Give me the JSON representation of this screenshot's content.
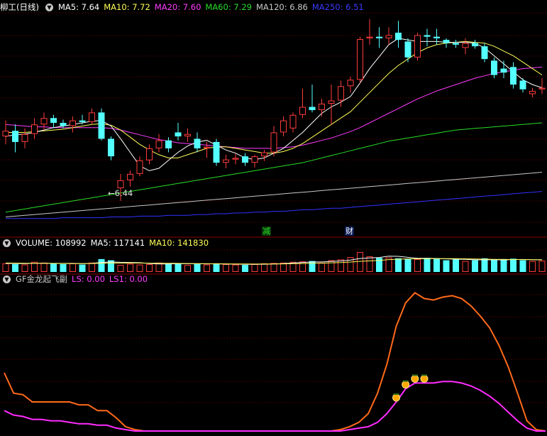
{
  "colors": {
    "up": "#ff3c3c",
    "down": "#54ffff",
    "grid": "#7a0000",
    "divider": "#8b0000",
    "ma5": "#ffffff",
    "ma10": "#ffff5a",
    "ma20": "#ff3cff",
    "ma60": "#28dc28",
    "ma120": "#c8c8c8",
    "ma250": "#3232ff",
    "ls": "#ff6a1a",
    "ls1": "#ff2cff",
    "marker": "#ffaa00"
  },
  "main": {
    "title": "柳工(日线)",
    "legend": [
      {
        "name": "MA5",
        "value": "7.64",
        "color": "#ffffff"
      },
      {
        "name": "MA10",
        "value": "7.72",
        "color": "#ffff5a"
      },
      {
        "name": "MA20",
        "value": "7.60",
        "color": "#ff3cff"
      },
      {
        "name": "MA60",
        "value": "7.29",
        "color": "#28dc28"
      },
      {
        "name": "MA120",
        "value": "6.86",
        "color": "#c8c8c8"
      },
      {
        "name": "MA250",
        "value": "6.51",
        "color": "#3232ff"
      }
    ],
    "low_label": "6.44",
    "badges": [
      {
        "text": "减",
        "color": "#28dc28",
        "bg": "#0a3a0a"
      },
      {
        "text": "财",
        "color": "#ffffff",
        "bg": "#0a1a55"
      }
    ]
  },
  "volume": {
    "legend": [
      {
        "name": "VOLUME",
        "value": "108992",
        "color": "#ffffff"
      },
      {
        "name": "MA5",
        "value": "117141",
        "color": "#ffffff"
      },
      {
        "name": "MA10",
        "value": "141830",
        "color": "#ffff5a"
      }
    ]
  },
  "indicator": {
    "title": "GF金龙起飞副",
    "legend": [
      {
        "name": "LS",
        "value": "0.00",
        "color": "#ff3cff"
      },
      {
        "name": "LS1",
        "value": "0.00",
        "color": "#ff3cff"
      }
    ]
  },
  "chart_data": [
    {
      "type": "candlestick",
      "title": "柳工(日线)",
      "ylim": [
        6.2,
        8.8
      ],
      "candles": [
        {
          "o": 7.25,
          "h": 7.45,
          "l": 7.15,
          "c": 7.32
        },
        {
          "o": 7.32,
          "h": 7.4,
          "l": 7.05,
          "c": 7.18
        },
        {
          "o": 7.18,
          "h": 7.35,
          "l": 7.1,
          "c": 7.28
        },
        {
          "o": 7.28,
          "h": 7.48,
          "l": 7.22,
          "c": 7.4
        },
        {
          "o": 7.4,
          "h": 7.55,
          "l": 7.33,
          "c": 7.48
        },
        {
          "o": 7.48,
          "h": 7.52,
          "l": 7.36,
          "c": 7.42
        },
        {
          "o": 7.42,
          "h": 7.46,
          "l": 7.35,
          "c": 7.38
        },
        {
          "o": 7.38,
          "h": 7.5,
          "l": 7.3,
          "c": 7.45
        },
        {
          "o": 7.45,
          "h": 7.52,
          "l": 7.4,
          "c": 7.43
        },
        {
          "o": 7.43,
          "h": 7.6,
          "l": 7.4,
          "c": 7.55
        },
        {
          "o": 7.55,
          "h": 7.6,
          "l": 7.2,
          "c": 7.22
        },
        {
          "o": 7.22,
          "h": 7.25,
          "l": 6.95,
          "c": 7.0
        },
        {
          "o": 6.6,
          "h": 6.78,
          "l": 6.44,
          "c": 6.7
        },
        {
          "o": 6.7,
          "h": 6.82,
          "l": 6.62,
          "c": 6.78
        },
        {
          "o": 6.78,
          "h": 7.0,
          "l": 6.75,
          "c": 6.95
        },
        {
          "o": 6.95,
          "h": 7.15,
          "l": 6.9,
          "c": 7.1
        },
        {
          "o": 7.1,
          "h": 7.28,
          "l": 7.05,
          "c": 7.2
        },
        {
          "o": 7.2,
          "h": 7.24,
          "l": 7.05,
          "c": 7.1
        },
        {
          "o": 7.3,
          "h": 7.42,
          "l": 7.2,
          "c": 7.25
        },
        {
          "o": 7.25,
          "h": 7.35,
          "l": 7.18,
          "c": 7.28
        },
        {
          "o": 7.22,
          "h": 7.3,
          "l": 7.05,
          "c": 7.1
        },
        {
          "o": 7.1,
          "h": 7.18,
          "l": 6.98,
          "c": 7.12
        },
        {
          "o": 7.18,
          "h": 7.22,
          "l": 6.88,
          "c": 6.92
        },
        {
          "o": 6.92,
          "h": 7.02,
          "l": 6.85,
          "c": 6.96
        },
        {
          "o": 6.96,
          "h": 7.03,
          "l": 6.9,
          "c": 6.98
        },
        {
          "o": 7.0,
          "h": 7.04,
          "l": 6.88,
          "c": 6.92
        },
        {
          "o": 6.92,
          "h": 7.02,
          "l": 6.86,
          "c": 7.0
        },
        {
          "o": 7.0,
          "h": 7.08,
          "l": 6.94,
          "c": 7.05
        },
        {
          "o": 7.05,
          "h": 7.38,
          "l": 7.0,
          "c": 7.3
        },
        {
          "o": 7.3,
          "h": 7.5,
          "l": 7.25,
          "c": 7.45
        },
        {
          "o": 7.35,
          "h": 7.55,
          "l": 7.3,
          "c": 7.52
        },
        {
          "o": 7.52,
          "h": 7.85,
          "l": 7.48,
          "c": 7.62
        },
        {
          "o": 7.62,
          "h": 7.9,
          "l": 7.55,
          "c": 7.58
        },
        {
          "o": 7.58,
          "h": 7.72,
          "l": 7.5,
          "c": 7.66
        },
        {
          "o": 7.66,
          "h": 7.9,
          "l": 7.4,
          "c": 7.7
        },
        {
          "o": 7.7,
          "h": 7.95,
          "l": 7.62,
          "c": 7.88
        },
        {
          "o": 7.88,
          "h": 8.0,
          "l": 7.8,
          "c": 7.96
        },
        {
          "o": 7.96,
          "h": 8.5,
          "l": 7.92,
          "c": 8.47
        },
        {
          "o": 8.48,
          "h": 8.72,
          "l": 8.4,
          "c": 8.5
        },
        {
          "o": 8.5,
          "h": 8.62,
          "l": 8.36,
          "c": 8.48
        },
        {
          "o": 8.48,
          "h": 8.62,
          "l": 8.4,
          "c": 8.52
        },
        {
          "o": 8.55,
          "h": 8.7,
          "l": 8.36,
          "c": 8.46
        },
        {
          "o": 8.44,
          "h": 8.48,
          "l": 8.18,
          "c": 8.24
        },
        {
          "o": 8.24,
          "h": 8.55,
          "l": 8.2,
          "c": 8.52
        },
        {
          "o": 8.52,
          "h": 8.6,
          "l": 8.38,
          "c": 8.5
        },
        {
          "o": 8.5,
          "h": 8.6,
          "l": 8.4,
          "c": 8.48
        },
        {
          "o": 8.46,
          "h": 8.48,
          "l": 8.36,
          "c": 8.42
        },
        {
          "o": 8.42,
          "h": 8.46,
          "l": 8.36,
          "c": 8.4
        },
        {
          "o": 8.36,
          "h": 8.48,
          "l": 8.28,
          "c": 8.42
        },
        {
          "o": 8.42,
          "h": 8.46,
          "l": 8.35,
          "c": 8.38
        },
        {
          "o": 8.38,
          "h": 8.42,
          "l": 8.18,
          "c": 8.22
        },
        {
          "o": 8.2,
          "h": 8.24,
          "l": 7.98,
          "c": 8.02
        },
        {
          "o": 8.1,
          "h": 8.2,
          "l": 7.98,
          "c": 8.05
        },
        {
          "o": 8.12,
          "h": 8.18,
          "l": 7.85,
          "c": 7.9
        },
        {
          "o": 7.95,
          "h": 7.98,
          "l": 7.8,
          "c": 7.84
        },
        {
          "o": 7.78,
          "h": 7.86,
          "l": 7.74,
          "c": 7.82
        },
        {
          "o": 7.84,
          "h": 7.98,
          "l": 7.78,
          "c": 7.86
        }
      ],
      "series": [
        {
          "name": "MA5",
          "color": "#ffffff",
          "values": [
            7.25,
            7.27,
            7.28,
            7.3,
            7.33,
            7.36,
            7.38,
            7.4,
            7.42,
            7.44,
            7.45,
            7.38,
            7.22,
            7.05,
            6.88,
            6.82,
            6.85,
            6.95,
            7.05,
            7.13,
            7.18,
            7.2,
            7.14,
            7.08,
            7.04,
            6.98,
            6.96,
            6.98,
            7.04,
            7.1,
            7.2,
            7.3,
            7.42,
            7.54,
            7.62,
            7.68,
            7.75,
            7.92,
            8.1,
            8.25,
            8.4,
            8.48,
            8.46,
            8.44,
            8.44,
            8.44,
            8.43,
            8.43,
            8.43,
            8.42,
            8.36,
            8.26,
            8.16,
            8.06,
            7.96,
            7.9,
            7.86
          ]
        },
        {
          "name": "MA10",
          "color": "#ffff5a",
          "values": [
            7.3,
            7.3,
            7.3,
            7.31,
            7.32,
            7.33,
            7.34,
            7.36,
            7.38,
            7.4,
            7.41,
            7.39,
            7.33,
            7.24,
            7.15,
            7.08,
            7.02,
            6.98,
            6.98,
            7.02,
            7.06,
            7.1,
            7.12,
            7.12,
            7.1,
            7.08,
            7.06,
            7.04,
            7.04,
            7.06,
            7.1,
            7.16,
            7.24,
            7.32,
            7.4,
            7.48,
            7.56,
            7.68,
            7.8,
            7.92,
            8.04,
            8.14,
            8.22,
            8.3,
            8.36,
            8.4,
            8.42,
            8.43,
            8.44,
            8.43,
            8.42,
            8.38,
            8.32,
            8.26,
            8.18,
            8.1,
            8.02
          ]
        },
        {
          "name": "MA20",
          "color": "#ff3cff",
          "values": [
            7.4,
            7.39,
            7.38,
            7.37,
            7.37,
            7.36,
            7.36,
            7.36,
            7.36,
            7.36,
            7.36,
            7.35,
            7.33,
            7.3,
            7.27,
            7.24,
            7.21,
            7.19,
            7.17,
            7.16,
            7.15,
            7.14,
            7.13,
            7.12,
            7.11,
            7.1,
            7.1,
            7.1,
            7.1,
            7.11,
            7.12,
            7.14,
            7.17,
            7.2,
            7.23,
            7.27,
            7.31,
            7.36,
            7.42,
            7.48,
            7.54,
            7.6,
            7.66,
            7.72,
            7.77,
            7.82,
            7.86,
            7.9,
            7.94,
            7.98,
            8.01,
            8.04,
            8.06,
            8.08,
            8.1,
            8.11,
            8.12
          ]
        },
        {
          "name": "MA60",
          "color": "#28dc28",
          "values": [
            6.3,
            6.32,
            6.34,
            6.36,
            6.38,
            6.4,
            6.42,
            6.44,
            6.46,
            6.48,
            6.5,
            6.52,
            6.54,
            6.56,
            6.58,
            6.6,
            6.62,
            6.64,
            6.66,
            6.68,
            6.7,
            6.72,
            6.74,
            6.76,
            6.78,
            6.8,
            6.82,
            6.84,
            6.86,
            6.88,
            6.9,
            6.92,
            6.95,
            6.98,
            7.01,
            7.04,
            7.07,
            7.1,
            7.13,
            7.16,
            7.19,
            7.21,
            7.23,
            7.25,
            7.27,
            7.29,
            7.31,
            7.33,
            7.34,
            7.35,
            7.36,
            7.37,
            7.38,
            7.39,
            7.4,
            7.41,
            7.42
          ]
        },
        {
          "name": "MA120",
          "color": "#c8c8c8",
          "values": [
            6.24,
            6.25,
            6.26,
            6.27,
            6.28,
            6.29,
            6.3,
            6.31,
            6.32,
            6.33,
            6.34,
            6.35,
            6.36,
            6.37,
            6.38,
            6.39,
            6.4,
            6.41,
            6.42,
            6.43,
            6.44,
            6.45,
            6.46,
            6.47,
            6.48,
            6.49,
            6.5,
            6.51,
            6.52,
            6.53,
            6.54,
            6.55,
            6.56,
            6.57,
            6.58,
            6.59,
            6.6,
            6.61,
            6.62,
            6.63,
            6.64,
            6.65,
            6.66,
            6.67,
            6.68,
            6.69,
            6.7,
            6.71,
            6.72,
            6.73,
            6.74,
            6.75,
            6.76,
            6.77,
            6.78,
            6.79,
            6.8
          ]
        },
        {
          "name": "MA250",
          "color": "#3232ff",
          "values": [
            6.22,
            6.22,
            6.22,
            6.22,
            6.22,
            6.22,
            6.23,
            6.23,
            6.23,
            6.23,
            6.23,
            6.24,
            6.24,
            6.24,
            6.25,
            6.25,
            6.25,
            6.26,
            6.26,
            6.26,
            6.27,
            6.27,
            6.28,
            6.28,
            6.29,
            6.29,
            6.3,
            6.3,
            6.31,
            6.31,
            6.32,
            6.33,
            6.33,
            6.34,
            6.35,
            6.35,
            6.36,
            6.37,
            6.38,
            6.39,
            6.4,
            6.41,
            6.42,
            6.43,
            6.44,
            6.45,
            6.46,
            6.47,
            6.48,
            6.49,
            6.5,
            6.51,
            6.52,
            6.53,
            6.54,
            6.55,
            6.56
          ]
        }
      ]
    },
    {
      "type": "bar",
      "title": "VOLUME",
      "ylim": [
        0,
        300
      ],
      "values": [
        110,
        100,
        95,
        130,
        120,
        105,
        100,
        110,
        95,
        120,
        165,
        150,
        90,
        105,
        95,
        100,
        120,
        105,
        110,
        90,
        100,
        95,
        110,
        100,
        95,
        90,
        100,
        110,
        115,
        120,
        130,
        135,
        140,
        120,
        150,
        160,
        190,
        255,
        200,
        180,
        185,
        175,
        170,
        165,
        180,
        175,
        150,
        160,
        140,
        150,
        175,
        155,
        165,
        170,
        150,
        140,
        145
      ],
      "series": [
        {
          "name": "MA5",
          "color": "#ffffff",
          "values": [
            110,
            108,
            106,
            110,
            111,
            110,
            110,
            110,
            106,
            110,
            122,
            128,
            124,
            122,
            119,
            108,
            102,
            103,
            106,
            105,
            105,
            104,
            105,
            101,
            100,
            98,
            97,
            99,
            103,
            107,
            115,
            122,
            128,
            128,
            135,
            141,
            152,
            173,
            179,
            185,
            202,
            200,
            187,
            175,
            175,
            173,
            168,
            164,
            161,
            155,
            155,
            156,
            154,
            159,
            160,
            156,
            155
          ]
        },
        {
          "name": "MA10",
          "color": "#ffff5a",
          "values": [
            115,
            114,
            112,
            111,
            110,
            109,
            108,
            108,
            107,
            108,
            113,
            116,
            115,
            116,
            115,
            113,
            112,
            112,
            110,
            108,
            107,
            105,
            104,
            104,
            103,
            102,
            101,
            102,
            103,
            104,
            106,
            108,
            111,
            113,
            117,
            121,
            127,
            136,
            142,
            148,
            158,
            164,
            167,
            168,
            170,
            170,
            170,
            170,
            168,
            166,
            164,
            162,
            160,
            159,
            158,
            157,
            156
          ]
        }
      ]
    },
    {
      "type": "line",
      "title": "GF金龙起飞副",
      "ylim": [
        0,
        100
      ],
      "x_count": 57,
      "series": [
        {
          "name": "LS",
          "color": "#ff6a1a",
          "values": [
            40,
            26,
            25,
            20,
            20,
            20,
            20,
            20,
            18,
            18,
            14,
            14,
            9,
            3,
            1,
            0,
            0,
            0,
            0,
            0,
            0,
            0,
            0,
            0,
            0,
            0,
            0,
            0,
            0,
            0,
            0,
            0,
            0,
            0,
            0,
            0,
            1,
            3,
            6,
            12,
            26,
            46,
            72,
            88,
            95,
            91,
            90,
            92,
            93,
            91,
            86,
            79,
            71,
            59,
            44,
            26,
            7,
            1,
            0
          ]
        },
        {
          "name": "LS1",
          "color": "#ff2cff",
          "values": [
            14,
            11,
            10,
            8,
            8,
            7,
            7,
            6,
            5,
            5,
            4,
            4,
            2,
            1,
            0,
            0,
            0,
            0,
            0,
            0,
            0,
            0,
            0,
            0,
            0,
            0,
            0,
            0,
            0,
            0,
            0,
            0,
            0,
            0,
            0,
            0,
            0,
            1,
            2,
            3,
            6,
            12,
            20,
            29,
            33,
            33,
            33,
            34,
            34,
            33,
            31,
            28,
            24,
            19,
            13,
            7,
            2,
            0,
            0
          ]
        }
      ],
      "markers": [
        34,
        35,
        36,
        37
      ]
    }
  ]
}
